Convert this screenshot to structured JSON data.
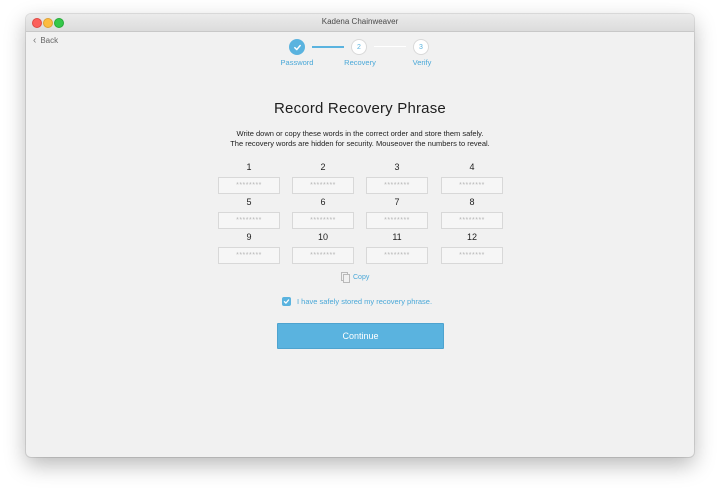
{
  "window": {
    "title": "Kadena Chainweaver"
  },
  "nav": {
    "back_label": "Back"
  },
  "stepper": {
    "steps": [
      {
        "number": "1",
        "label": "Password",
        "state": "completed"
      },
      {
        "number": "2",
        "label": "Recovery",
        "state": "current"
      },
      {
        "number": "3",
        "label": "Verify",
        "state": "upcoming"
      }
    ]
  },
  "main": {
    "heading": "Record Recovery Phrase",
    "description_line1": "Write down or copy these words in the correct order and store them safely.",
    "description_line2": "The recovery words are hidden for security. Mouseover the numbers to reveal.",
    "words": [
      {
        "number": "1",
        "masked": "********"
      },
      {
        "number": "2",
        "masked": "********"
      },
      {
        "number": "3",
        "masked": "********"
      },
      {
        "number": "4",
        "masked": "********"
      },
      {
        "number": "5",
        "masked": "********"
      },
      {
        "number": "6",
        "masked": "********"
      },
      {
        "number": "7",
        "masked": "********"
      },
      {
        "number": "8",
        "masked": "********"
      },
      {
        "number": "9",
        "masked": "********"
      },
      {
        "number": "10",
        "masked": "********"
      },
      {
        "number": "11",
        "masked": "********"
      },
      {
        "number": "12",
        "masked": "********"
      }
    ],
    "copy_label": "Copy",
    "confirm_label": "I have safely stored my recovery phrase.",
    "confirm_checked": true,
    "continue_label": "Continue"
  },
  "colors": {
    "accent": "#5ab3df",
    "link": "#4aa8d8",
    "background": "#f1f1f1"
  },
  "icons": {
    "back": "chevron-left-icon",
    "step_done": "checkmark-icon",
    "copy": "copy-icon",
    "checkbox": "checkmark-icon"
  }
}
